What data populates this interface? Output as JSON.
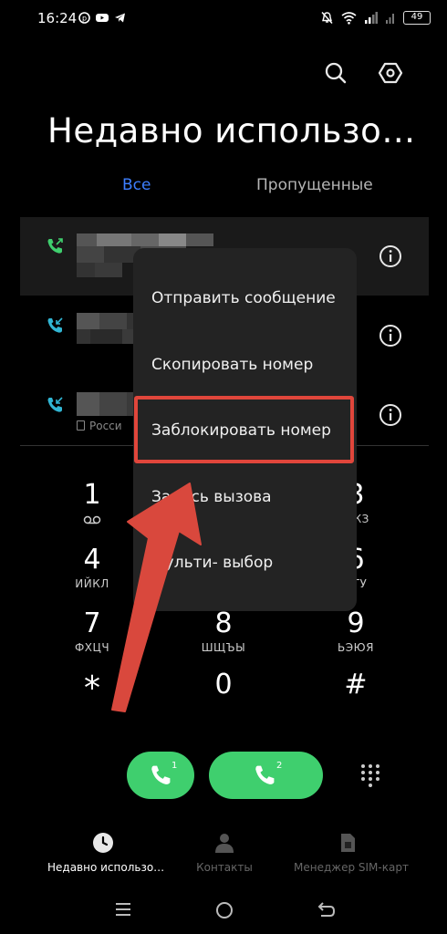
{
  "status_bar": {
    "time": "16:24",
    "battery": "49"
  },
  "screen_title": "Недавно использо…",
  "tabs": [
    {
      "label": "Все",
      "active": true
    },
    {
      "label": "Пропущенные",
      "active": false
    }
  ],
  "calls": [
    {
      "type": "outgoing",
      "sim_note": ""
    },
    {
      "type": "incoming",
      "sim_note": ""
    },
    {
      "type": "incoming",
      "sim_note": "Росси"
    }
  ],
  "context_menu": {
    "items": [
      "Отправить сообщение",
      "Скопировать номер",
      "Заблокировать номер",
      "Запись вызова",
      "Мульти- выбор"
    ],
    "highlighted_index": 2
  },
  "keypad": [
    {
      "digit": "1",
      "letters": ""
    },
    {
      "digit": "3",
      "letters": "ЁЖЗ"
    },
    {
      "digit": "4",
      "letters": "ИЙКЛ"
    },
    {
      "digit": "6",
      "letters": "СТУ"
    },
    {
      "digit": "7",
      "letters": "ФХЦЧ"
    },
    {
      "digit": "8",
      "letters": "ШЩЪЫ"
    },
    {
      "digit": "9",
      "letters": "ЬЭЮЯ"
    },
    {
      "digit": "*",
      "letters": ""
    },
    {
      "digit": "0",
      "letters": ""
    },
    {
      "digit": "#",
      "letters": ""
    }
  ],
  "call_buttons": [
    {
      "sim": "1"
    },
    {
      "sim": "2"
    }
  ],
  "bottom_nav": [
    {
      "label": "Недавно использо…",
      "icon": "clock-icon",
      "active": true
    },
    {
      "label": "Контакты",
      "icon": "person-icon",
      "active": false
    },
    {
      "label": "Менеджер SIM-карт",
      "icon": "sim-card-icon",
      "active": false
    }
  ],
  "colors": {
    "accent_blue": "#3d7fff",
    "call_green": "#3fcf6e",
    "highlight_red": "#e0463b",
    "outgoing_call": "#3fcf6e",
    "incoming_call": "#31b6d4"
  }
}
